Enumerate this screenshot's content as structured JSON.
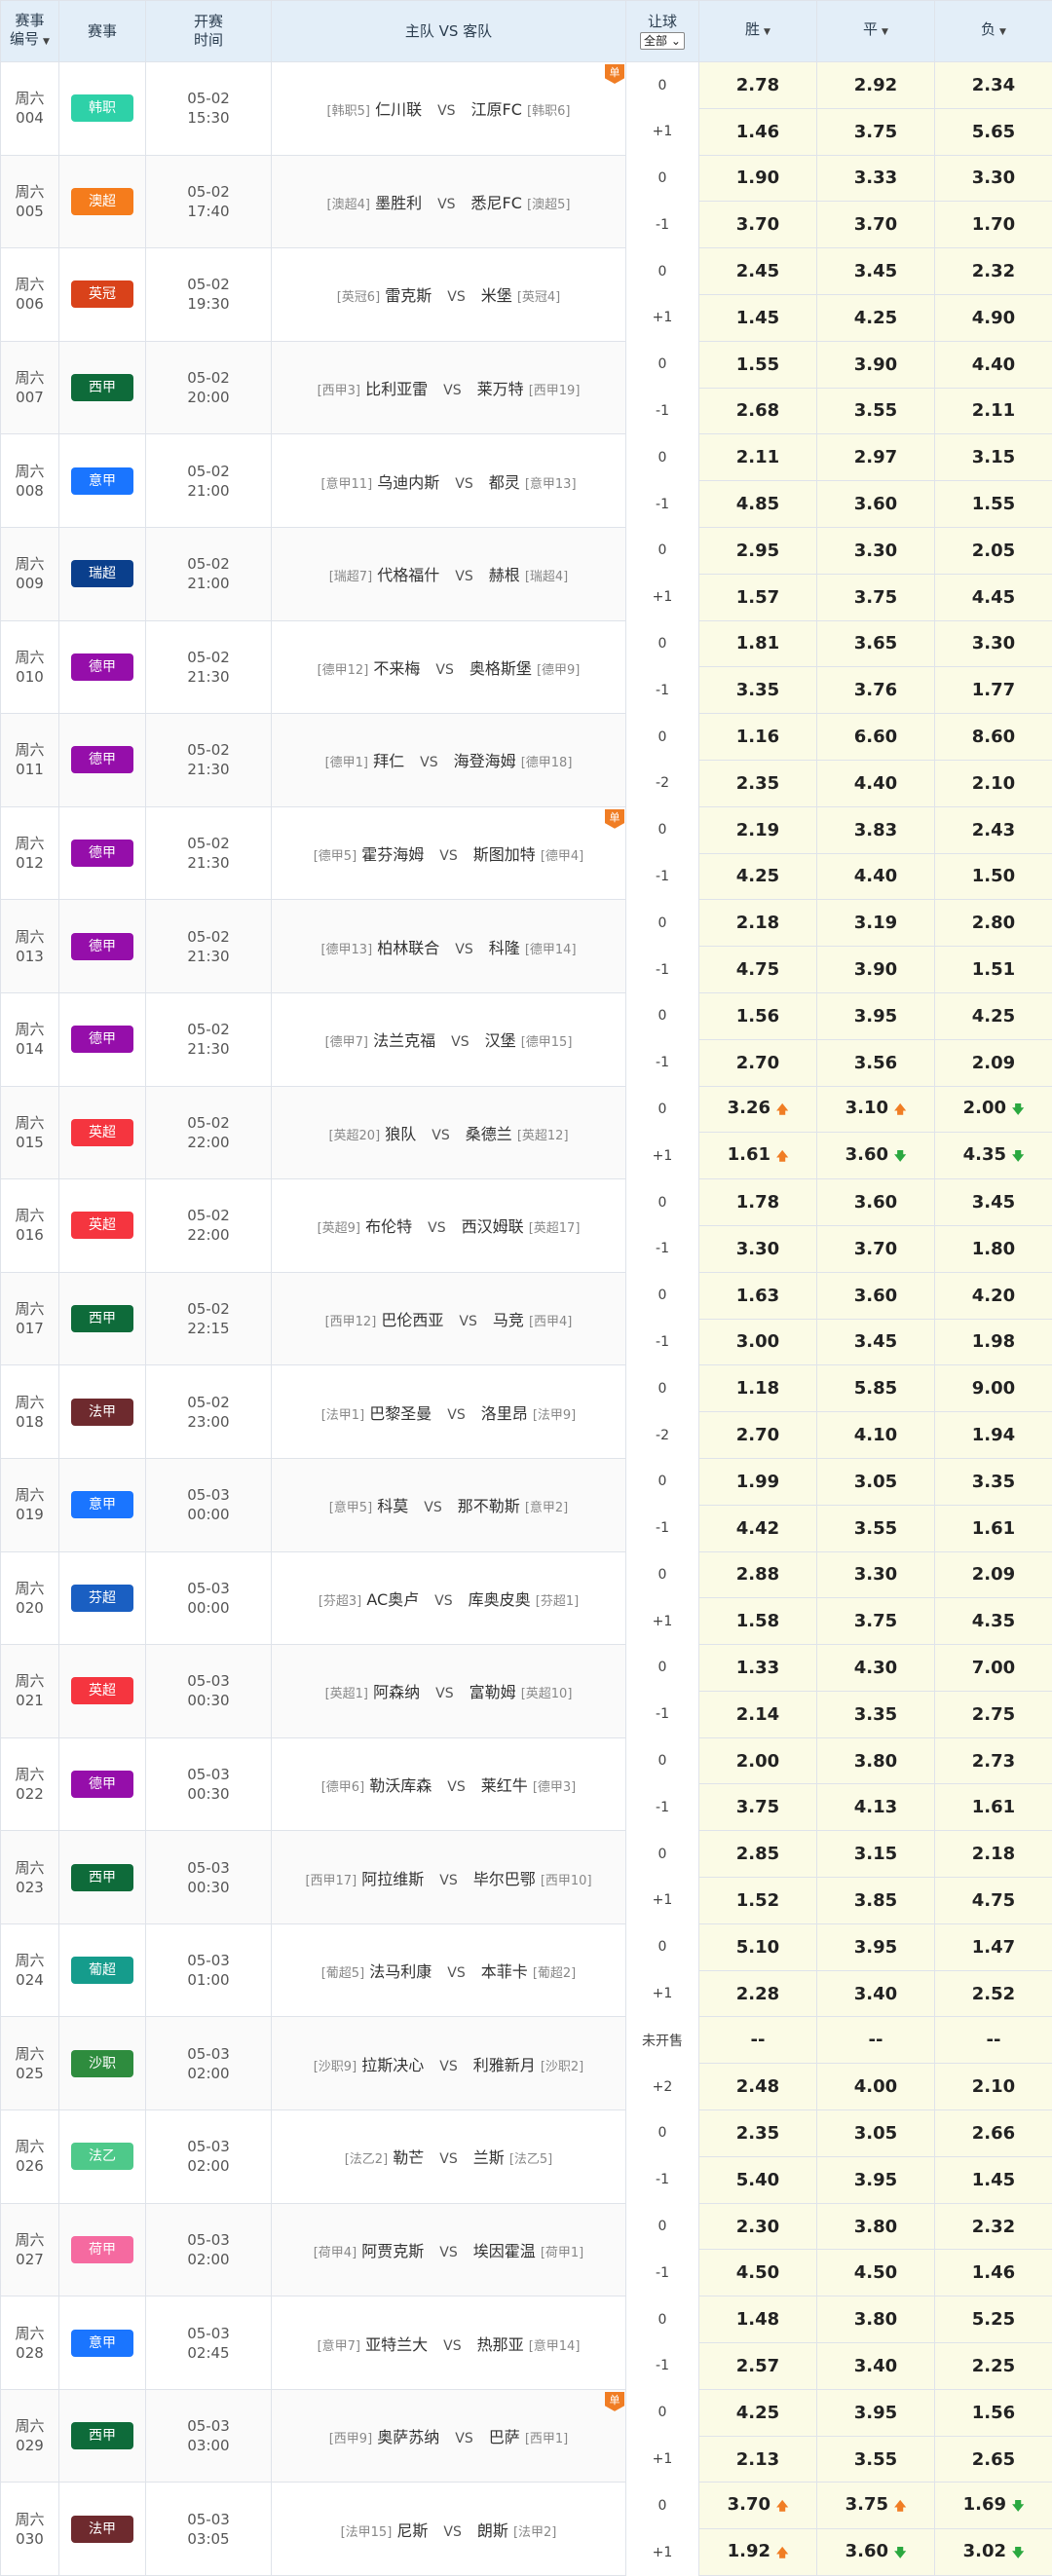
{
  "header": {
    "match_no": "赛事\n编号",
    "league": "赛事",
    "kickoff": "开赛\n时间",
    "teams": "主队 VS 客队",
    "handicap": "让球",
    "handicap_filter": "全部",
    "win": "胜",
    "draw": "平",
    "lose": "负"
  },
  "matches": [
    {
      "day": "周六",
      "num": "004",
      "league": "韩职",
      "color": "#2ed1a8",
      "date": "05-02",
      "time": "15:30",
      "home_rank": "[韩职5]",
      "home": "仁川联",
      "away": "江原FC",
      "away_rank": "[韩职6]",
      "flag": "单",
      "r1": {
        "h": "0",
        "w": "2.78",
        "d": "2.92",
        "l": "2.34"
      },
      "r2": {
        "h": "+1",
        "w": "1.46",
        "d": "3.75",
        "l": "5.65"
      }
    },
    {
      "day": "周六",
      "num": "005",
      "league": "澳超",
      "color": "#f57c1c",
      "date": "05-02",
      "time": "17:40",
      "home_rank": "[澳超4]",
      "home": "墨胜利",
      "away": "悉尼FC",
      "away_rank": "[澳超5]",
      "r1": {
        "h": "0",
        "w": "1.90",
        "d": "3.33",
        "l": "3.30"
      },
      "r2": {
        "h": "-1",
        "w": "3.70",
        "d": "3.70",
        "l": "1.70"
      }
    },
    {
      "day": "周六",
      "num": "006",
      "league": "英冠",
      "color": "#d9421a",
      "date": "05-02",
      "time": "19:30",
      "home_rank": "[英冠6]",
      "home": "雷克斯",
      "away": "米堡",
      "away_rank": "[英冠4]",
      "r1": {
        "h": "0",
        "w": "2.45",
        "d": "3.45",
        "l": "2.32"
      },
      "r2": {
        "h": "+1",
        "w": "1.45",
        "d": "4.25",
        "l": "4.90"
      }
    },
    {
      "day": "周六",
      "num": "007",
      "league": "西甲",
      "color": "#0e6b3a",
      "date": "05-02",
      "time": "20:00",
      "home_rank": "[西甲3]",
      "home": "比利亚雷",
      "away": "莱万特",
      "away_rank": "[西甲19]",
      "r1": {
        "h": "0",
        "w": "1.55",
        "d": "3.90",
        "l": "4.40"
      },
      "r2": {
        "h": "-1",
        "w": "2.68",
        "d": "3.55",
        "l": "2.11"
      }
    },
    {
      "day": "周六",
      "num": "008",
      "league": "意甲",
      "color": "#1a75ff",
      "date": "05-02",
      "time": "21:00",
      "home_rank": "[意甲11]",
      "home": "乌迪内斯",
      "away": "都灵",
      "away_rank": "[意甲13]",
      "r1": {
        "h": "0",
        "w": "2.11",
        "d": "2.97",
        "l": "3.15"
      },
      "r2": {
        "h": "-1",
        "w": "4.85",
        "d": "3.60",
        "l": "1.55"
      }
    },
    {
      "day": "周六",
      "num": "009",
      "league": "瑞超",
      "color": "#0a3f8c",
      "date": "05-02",
      "time": "21:00",
      "home_rank": "[瑞超7]",
      "home": "代格福什",
      "away": "赫根",
      "away_rank": "[瑞超4]",
      "r1": {
        "h": "0",
        "w": "2.95",
        "d": "3.30",
        "l": "2.05"
      },
      "r2": {
        "h": "+1",
        "w": "1.57",
        "d": "3.75",
        "l": "4.45"
      }
    },
    {
      "day": "周六",
      "num": "010",
      "league": "德甲",
      "color": "#950eaa",
      "date": "05-02",
      "time": "21:30",
      "home_rank": "[德甲12]",
      "home": "不来梅",
      "away": "奥格斯堡",
      "away_rank": "[德甲9]",
      "r1": {
        "h": "0",
        "w": "1.81",
        "d": "3.65",
        "l": "3.30"
      },
      "r2": {
        "h": "-1",
        "w": "3.35",
        "d": "3.76",
        "l": "1.77"
      }
    },
    {
      "day": "周六",
      "num": "011",
      "league": "德甲",
      "color": "#950eaa",
      "date": "05-02",
      "time": "21:30",
      "home_rank": "[德甲1]",
      "home": "拜仁",
      "away": "海登海姆",
      "away_rank": "[德甲18]",
      "r1": {
        "h": "0",
        "w": "1.16",
        "d": "6.60",
        "l": "8.60"
      },
      "r2": {
        "h": "-2",
        "w": "2.35",
        "d": "4.40",
        "l": "2.10"
      }
    },
    {
      "day": "周六",
      "num": "012",
      "league": "德甲",
      "color": "#950eaa",
      "date": "05-02",
      "time": "21:30",
      "home_rank": "[德甲5]",
      "home": "霍芬海姆",
      "away": "斯图加特",
      "away_rank": "[德甲4]",
      "flag": "单",
      "r1": {
        "h": "0",
        "w": "2.19",
        "d": "3.83",
        "l": "2.43"
      },
      "r2": {
        "h": "-1",
        "w": "4.25",
        "d": "4.40",
        "l": "1.50"
      }
    },
    {
      "day": "周六",
      "num": "013",
      "league": "德甲",
      "color": "#950eaa",
      "date": "05-02",
      "time": "21:30",
      "home_rank": "[德甲13]",
      "home": "柏林联合",
      "away": "科隆",
      "away_rank": "[德甲14]",
      "r1": {
        "h": "0",
        "w": "2.18",
        "d": "3.19",
        "l": "2.80"
      },
      "r2": {
        "h": "-1",
        "w": "4.75",
        "d": "3.90",
        "l": "1.51"
      }
    },
    {
      "day": "周六",
      "num": "014",
      "league": "德甲",
      "color": "#950eaa",
      "date": "05-02",
      "time": "21:30",
      "home_rank": "[德甲7]",
      "home": "法兰克福",
      "away": "汉堡",
      "away_rank": "[德甲15]",
      "r1": {
        "h": "0",
        "w": "1.56",
        "d": "3.95",
        "l": "4.25"
      },
      "r2": {
        "h": "-1",
        "w": "2.70",
        "d": "3.56",
        "l": "2.09"
      }
    },
    {
      "day": "周六",
      "num": "015",
      "league": "英超",
      "color": "#f5353f",
      "date": "05-02",
      "time": "22:00",
      "home_rank": "[英超20]",
      "home": "狼队",
      "away": "桑德兰",
      "away_rank": "[英超12]",
      "r1": {
        "h": "0",
        "w": "3.26",
        "wa": "up",
        "d": "3.10",
        "da": "up",
        "l": "2.00",
        "la": "down"
      },
      "r2": {
        "h": "+1",
        "w": "1.61",
        "wa": "up",
        "d": "3.60",
        "da": "down",
        "l": "4.35",
        "la": "down"
      }
    },
    {
      "day": "周六",
      "num": "016",
      "league": "英超",
      "color": "#f5353f",
      "date": "05-02",
      "time": "22:00",
      "home_rank": "[英超9]",
      "home": "布伦特",
      "away": "西汉姆联",
      "away_rank": "[英超17]",
      "r1": {
        "h": "0",
        "w": "1.78",
        "d": "3.60",
        "l": "3.45"
      },
      "r2": {
        "h": "-1",
        "w": "3.30",
        "d": "3.70",
        "l": "1.80"
      }
    },
    {
      "day": "周六",
      "num": "017",
      "league": "西甲",
      "color": "#0e6b3a",
      "date": "05-02",
      "time": "22:15",
      "home_rank": "[西甲12]",
      "home": "巴伦西亚",
      "away": "马竞",
      "away_rank": "[西甲4]",
      "r1": {
        "h": "0",
        "w": "1.63",
        "d": "3.60",
        "l": "4.20"
      },
      "r2": {
        "h": "-1",
        "w": "3.00",
        "d": "3.45",
        "l": "1.98"
      }
    },
    {
      "day": "周六",
      "num": "018",
      "league": "法甲",
      "color": "#6e2a2e",
      "date": "05-02",
      "time": "23:00",
      "home_rank": "[法甲1]",
      "home": "巴黎圣曼",
      "away": "洛里昂",
      "away_rank": "[法甲9]",
      "r1": {
        "h": "0",
        "w": "1.18",
        "d": "5.85",
        "l": "9.00"
      },
      "r2": {
        "h": "-2",
        "w": "2.70",
        "d": "4.10",
        "l": "1.94"
      }
    },
    {
      "day": "周六",
      "num": "019",
      "league": "意甲",
      "color": "#1a75ff",
      "date": "05-03",
      "time": "00:00",
      "home_rank": "[意甲5]",
      "home": "科莫",
      "away": "那不勒斯",
      "away_rank": "[意甲2]",
      "r1": {
        "h": "0",
        "w": "1.99",
        "d": "3.05",
        "l": "3.35"
      },
      "r2": {
        "h": "-1",
        "w": "4.42",
        "d": "3.55",
        "l": "1.61"
      }
    },
    {
      "day": "周六",
      "num": "020",
      "league": "芬超",
      "color": "#1a5fc2",
      "date": "05-03",
      "time": "00:00",
      "home_rank": "[芬超3]",
      "home": "AC奥卢",
      "away": "库奥皮奥",
      "away_rank": "[芬超1]",
      "r1": {
        "h": "0",
        "w": "2.88",
        "d": "3.30",
        "l": "2.09"
      },
      "r2": {
        "h": "+1",
        "w": "1.58",
        "d": "3.75",
        "l": "4.35"
      }
    },
    {
      "day": "周六",
      "num": "021",
      "league": "英超",
      "color": "#f5353f",
      "date": "05-03",
      "time": "00:30",
      "home_rank": "[英超1]",
      "home": "阿森纳",
      "away": "富勒姆",
      "away_rank": "[英超10]",
      "r1": {
        "h": "0",
        "w": "1.33",
        "d": "4.30",
        "l": "7.00"
      },
      "r2": {
        "h": "-1",
        "w": "2.14",
        "d": "3.35",
        "l": "2.75"
      }
    },
    {
      "day": "周六",
      "num": "022",
      "league": "德甲",
      "color": "#950eaa",
      "date": "05-03",
      "time": "00:30",
      "home_rank": "[德甲6]",
      "home": "勒沃库森",
      "away": "莱红牛",
      "away_rank": "[德甲3]",
      "r1": {
        "h": "0",
        "w": "2.00",
        "d": "3.80",
        "l": "2.73"
      },
      "r2": {
        "h": "-1",
        "w": "3.75",
        "d": "4.13",
        "l": "1.61"
      }
    },
    {
      "day": "周六",
      "num": "023",
      "league": "西甲",
      "color": "#0e6b3a",
      "date": "05-03",
      "time": "00:30",
      "home_rank": "[西甲17]",
      "home": "阿拉维斯",
      "away": "毕尔巴鄂",
      "away_rank": "[西甲10]",
      "r1": {
        "h": "0",
        "w": "2.85",
        "d": "3.15",
        "l": "2.18"
      },
      "r2": {
        "h": "+1",
        "w": "1.52",
        "d": "3.85",
        "l": "4.75"
      }
    },
    {
      "day": "周六",
      "num": "024",
      "league": "葡超",
      "color": "#159c8c",
      "date": "05-03",
      "time": "01:00",
      "home_rank": "[葡超5]",
      "home": "法马利康",
      "away": "本菲卡",
      "away_rank": "[葡超2]",
      "r1": {
        "h": "0",
        "w": "5.10",
        "d": "3.95",
        "l": "1.47"
      },
      "r2": {
        "h": "+1",
        "w": "2.28",
        "d": "3.40",
        "l": "2.52"
      }
    },
    {
      "day": "周六",
      "num": "025",
      "league": "沙职",
      "color": "#2e8c3e",
      "date": "05-03",
      "time": "02:00",
      "home_rank": "[沙职9]",
      "home": "拉斯决心",
      "away": "利雅新月",
      "away_rank": "[沙职2]",
      "r1": {
        "h": "未开售",
        "w": "--",
        "d": "--",
        "l": "--"
      },
      "r2": {
        "h": "+2",
        "w": "2.48",
        "d": "4.00",
        "l": "2.10"
      }
    },
    {
      "day": "周六",
      "num": "026",
      "league": "法乙",
      "color": "#4ec98a",
      "date": "05-03",
      "time": "02:00",
      "home_rank": "[法乙2]",
      "home": "勒芒",
      "away": "兰斯",
      "away_rank": "[法乙5]",
      "r1": {
        "h": "0",
        "w": "2.35",
        "d": "3.05",
        "l": "2.66"
      },
      "r2": {
        "h": "-1",
        "w": "5.40",
        "d": "3.95",
        "l": "1.45"
      }
    },
    {
      "day": "周六",
      "num": "027",
      "league": "荷甲",
      "color": "#f56aa0",
      "date": "05-03",
      "time": "02:00",
      "home_rank": "[荷甲4]",
      "home": "阿贾克斯",
      "away": "埃因霍温",
      "away_rank": "[荷甲1]",
      "r1": {
        "h": "0",
        "w": "2.30",
        "d": "3.80",
        "l": "2.32"
      },
      "r2": {
        "h": "-1",
        "w": "4.50",
        "d": "4.50",
        "l": "1.46"
      }
    },
    {
      "day": "周六",
      "num": "028",
      "league": "意甲",
      "color": "#1a75ff",
      "date": "05-03",
      "time": "02:45",
      "home_rank": "[意甲7]",
      "home": "亚特兰大",
      "away": "热那亚",
      "away_rank": "[意甲14]",
      "r1": {
        "h": "0",
        "w": "1.48",
        "d": "3.80",
        "l": "5.25"
      },
      "r2": {
        "h": "-1",
        "w": "2.57",
        "d": "3.40",
        "l": "2.25"
      }
    },
    {
      "day": "周六",
      "num": "029",
      "league": "西甲",
      "color": "#0e6b3a",
      "date": "05-03",
      "time": "03:00",
      "home_rank": "[西甲9]",
      "home": "奥萨苏纳",
      "away": "巴萨",
      "away_rank": "[西甲1]",
      "flag": "单",
      "r1": {
        "h": "0",
        "w": "4.25",
        "d": "3.95",
        "l": "1.56"
      },
      "r2": {
        "h": "+1",
        "w": "2.13",
        "d": "3.55",
        "l": "2.65"
      }
    },
    {
      "day": "周六",
      "num": "030",
      "league": "法甲",
      "color": "#6e2a2e",
      "date": "05-03",
      "time": "03:05",
      "home_rank": "[法甲15]",
      "home": "尼斯",
      "away": "朗斯",
      "away_rank": "[法甲2]",
      "r1": {
        "h": "0",
        "w": "3.70",
        "wa": "up",
        "d": "3.75",
        "da": "up",
        "l": "1.69",
        "la": "down"
      },
      "r2": {
        "h": "+1",
        "w": "1.92",
        "wa": "up",
        "d": "3.60",
        "da": "down",
        "l": "3.02",
        "la": "down"
      }
    }
  ]
}
